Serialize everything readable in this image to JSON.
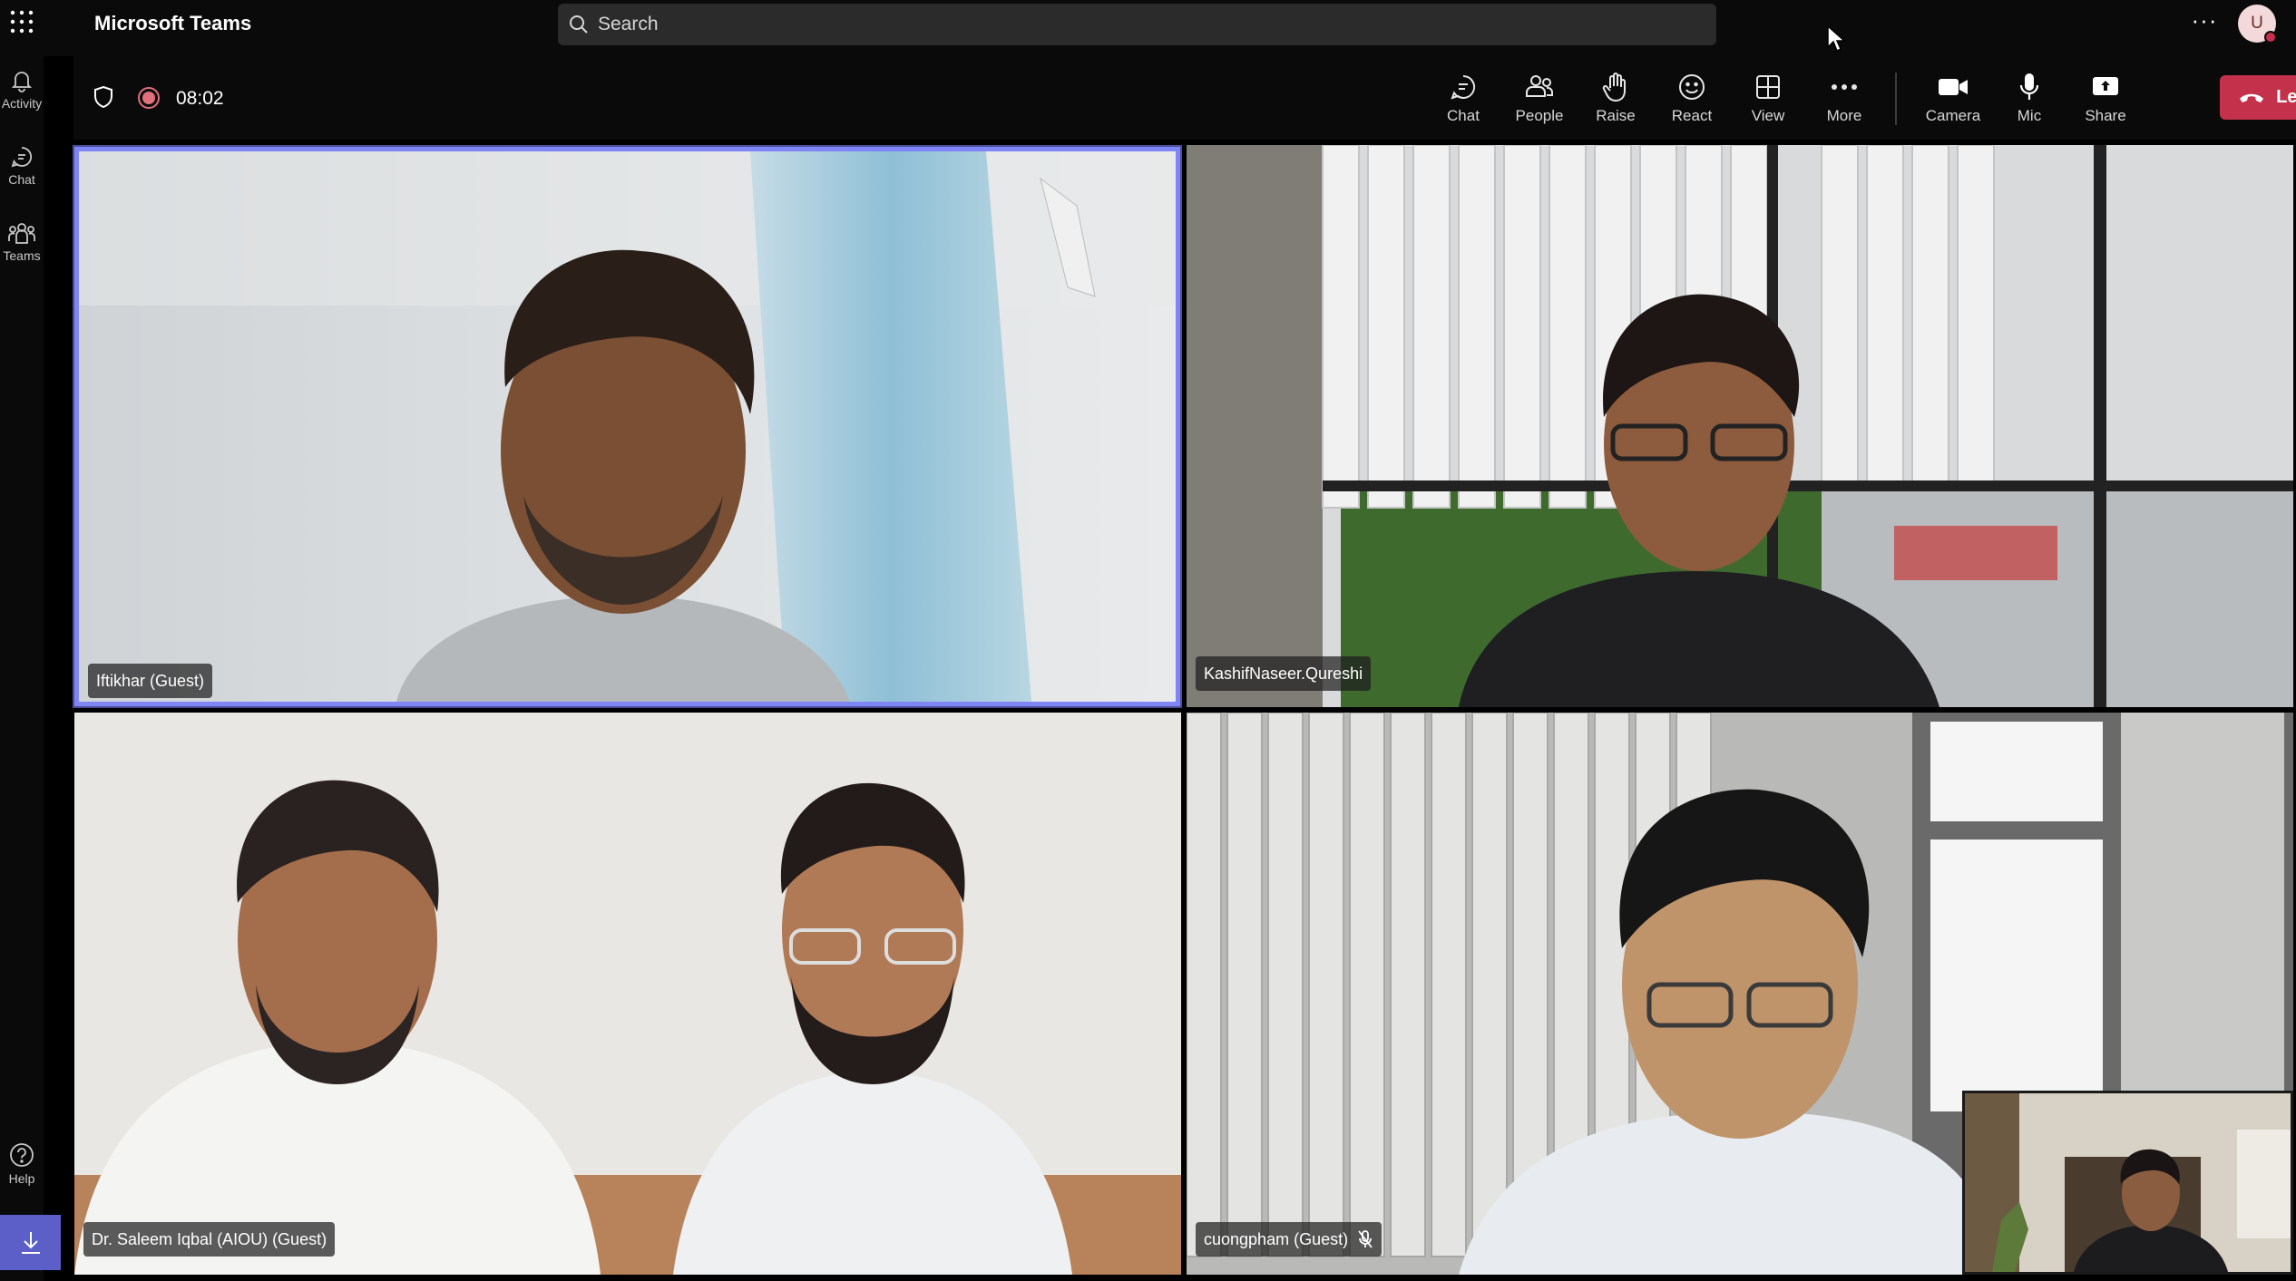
{
  "app": {
    "title": "Microsoft Teams",
    "search_placeholder": "Search",
    "more_glyph": "···",
    "avatar_initial": "U"
  },
  "rail": {
    "items": [
      {
        "label": "Activity",
        "icon": "bell-icon"
      },
      {
        "label": "Chat",
        "icon": "chat-icon"
      },
      {
        "label": "Teams",
        "icon": "teams-icon"
      }
    ],
    "help_label": "Help"
  },
  "meeting": {
    "timer": "08:02",
    "recording": true
  },
  "toolbar": {
    "chat": "Chat",
    "people": "People",
    "raise": "Raise",
    "react": "React",
    "view": "View",
    "more": "More",
    "camera": "Camera",
    "mic": "Mic",
    "share": "Share",
    "leave": "Leave"
  },
  "participants": [
    {
      "name": "Iftikhar (Guest)",
      "active_speaker": true
    },
    {
      "name": "KashifNaseer.Qureshi"
    },
    {
      "name": "Dr. Saleem Iqbal (AIOU) (Guest)"
    },
    {
      "name": "cuongpham (Guest)",
      "muted": true
    }
  ],
  "colors": {
    "accent": "#7f85f5",
    "leave": "#c4314b",
    "download": "#5b5fc7",
    "recording": "#e0707c"
  }
}
